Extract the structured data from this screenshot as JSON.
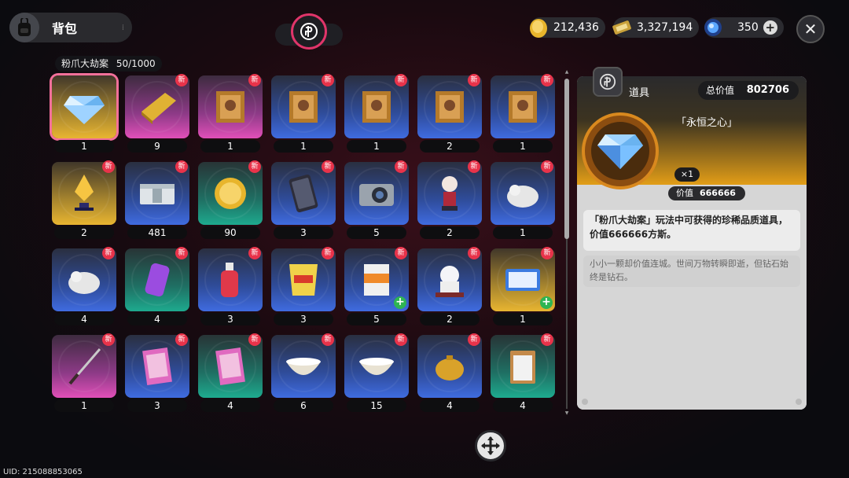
{
  "header": {
    "bag_title": "背包",
    "currencies": [
      {
        "name": "gold-coin",
        "value": "212,436"
      },
      {
        "name": "ticket",
        "value": "3,327,194"
      },
      {
        "name": "crystal",
        "value": "350"
      }
    ]
  },
  "collection": {
    "label": "粉爪大劫案",
    "progress": "50/1000"
  },
  "items": [
    {
      "icon": "diamond-icon",
      "count": "1",
      "rarity": "gold",
      "new": false,
      "selected": true,
      "plus": false
    },
    {
      "icon": "gold-bar-icon",
      "count": "9",
      "rarity": "pink",
      "new": true,
      "selected": false,
      "plus": false
    },
    {
      "icon": "painting-icon",
      "count": "1",
      "rarity": "pink",
      "new": true,
      "selected": false,
      "plus": false
    },
    {
      "icon": "painting-icon",
      "count": "1",
      "rarity": "blue",
      "new": true,
      "selected": false,
      "plus": false
    },
    {
      "icon": "painting-icon",
      "count": "1",
      "rarity": "blue",
      "new": true,
      "selected": false,
      "plus": false
    },
    {
      "icon": "painting-icon",
      "count": "2",
      "rarity": "blue",
      "new": true,
      "selected": false,
      "plus": false
    },
    {
      "icon": "painting-icon",
      "count": "1",
      "rarity": "blue",
      "new": true,
      "selected": false,
      "plus": false
    },
    {
      "icon": "trophy-icon",
      "count": "2",
      "rarity": "gold",
      "new": true,
      "selected": false,
      "plus": false
    },
    {
      "icon": "cash-stack-icon",
      "count": "481",
      "rarity": "blue",
      "new": true,
      "selected": false,
      "plus": false
    },
    {
      "icon": "coin-icon",
      "count": "90",
      "rarity": "teal",
      "new": true,
      "selected": true,
      "plus": false
    },
    {
      "icon": "phone-icon",
      "count": "3",
      "rarity": "blue",
      "new": true,
      "selected": false,
      "plus": false
    },
    {
      "icon": "camera-icon",
      "count": "5",
      "rarity": "blue",
      "new": true,
      "selected": false,
      "plus": false
    },
    {
      "icon": "figure-icon",
      "count": "2",
      "rarity": "blue",
      "new": true,
      "selected": false,
      "plus": false
    },
    {
      "icon": "plush-icon",
      "count": "1",
      "rarity": "blue",
      "new": true,
      "selected": false,
      "plus": false
    },
    {
      "icon": "plush-icon",
      "count": "4",
      "rarity": "blue",
      "new": true,
      "selected": false,
      "plus": false
    },
    {
      "icon": "soda-can-icon",
      "count": "4",
      "rarity": "teal",
      "new": true,
      "selected": false,
      "plus": false
    },
    {
      "icon": "bottle-icon",
      "count": "3",
      "rarity": "blue",
      "new": true,
      "selected": false,
      "plus": false
    },
    {
      "icon": "chips-icon",
      "count": "3",
      "rarity": "blue",
      "new": true,
      "selected": false,
      "plus": false
    },
    {
      "icon": "juice-box-icon",
      "count": "5",
      "rarity": "blue",
      "new": true,
      "selected": false,
      "plus": true
    },
    {
      "icon": "lucky-cat-icon",
      "count": "2",
      "rarity": "blue",
      "new": true,
      "selected": false,
      "plus": false
    },
    {
      "icon": "ticket-card-icon",
      "count": "1",
      "rarity": "gold",
      "new": true,
      "selected": false,
      "plus": true
    },
    {
      "icon": "katana-icon",
      "count": "1",
      "rarity": "pink",
      "new": true,
      "selected": false,
      "plus": false
    },
    {
      "icon": "magazine-icon",
      "count": "3",
      "rarity": "blue",
      "new": true,
      "selected": false,
      "plus": false
    },
    {
      "icon": "magazine-icon",
      "count": "4",
      "rarity": "teal",
      "new": true,
      "selected": false,
      "plus": false
    },
    {
      "icon": "bowl-icon",
      "count": "6",
      "rarity": "blue",
      "new": true,
      "selected": false,
      "plus": false
    },
    {
      "icon": "bowl-icon",
      "count": "15",
      "rarity": "blue",
      "new": true,
      "selected": false,
      "plus": false
    },
    {
      "icon": "teapot-icon",
      "count": "4",
      "rarity": "blue",
      "new": true,
      "selected": false,
      "plus": false
    },
    {
      "icon": "clipboard-icon",
      "count": "4",
      "rarity": "teal",
      "new": true,
      "selected": false,
      "plus": false
    }
  ],
  "badge_text": "新",
  "detail": {
    "category": "道具",
    "total_value_label": "总价值",
    "total_value": "802706",
    "item_name": "「永恒之心」",
    "quantity": "×1",
    "worth_label": "价值",
    "worth": "666666",
    "description": "「粉爪大劫案」玩法中可获得的珍稀品质道具，价值666666方斯。",
    "flavor": "小小一颗却价值连城。世间万物转瞬即逝，但钻石始终是钻石。"
  },
  "footer": {
    "uid": "UID: 215088853065"
  }
}
